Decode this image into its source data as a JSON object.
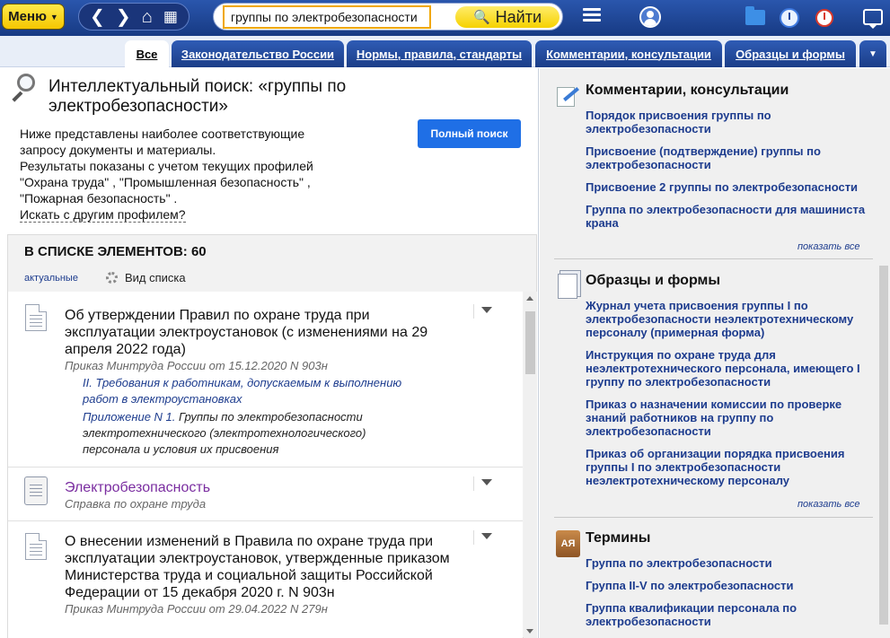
{
  "topbar": {
    "menu_label": "Меню",
    "search_value": "группы по электробезопасности",
    "find_label": "Найти"
  },
  "tabs": [
    {
      "label": "Все"
    },
    {
      "label": "Законодательство России"
    },
    {
      "label": "Нормы, правила, стандарты"
    },
    {
      "label": "Комментарии, консультации"
    },
    {
      "label": "Образцы и формы"
    }
  ],
  "main": {
    "title": "Интеллектуальный поиск: «группы по электробезопасности»",
    "intro_lines": [
      "Ниже представлены наиболее соответствующие",
      "запросу документы и материалы.",
      "Результаты показаны с учетом текущих профилей",
      "\"Охрана труда\" , \"Промышленная безопасность\" ,",
      "\"Пожарная безопасность\" ."
    ],
    "other_profile_link": "Искать с другим профилем?",
    "full_search_label": "Полный поиск",
    "list_header": "В СПИСКЕ ЭЛЕМЕНТОВ: 60",
    "actual_label": "актуальные",
    "view_list_label": "Вид списка",
    "documents": [
      {
        "title": "Об утверждении Правил по охране труда при эксплуатации электроустановок (с изменениями на 29 апреля 2022 года)",
        "subtitle": "Приказ Минтруда России от 15.12.2020 N 903н",
        "fragment1": "II. Требования к работникам, допускаемым к выполнению работ в электроустановках",
        "fragment2_link": "Приложение N 1.",
        "fragment2_text": " Группы по электробезопасности электротехнического (электротехнологического) персонала и условия их присвоения"
      },
      {
        "title": "Электробезопасность",
        "subtitle": "Справка по охране труда"
      },
      {
        "title": "О внесении изменений в Правила по охране труда при эксплуатации электроустановок, утвержденные приказом Министерства труда и социальной защиты Российской Федерации от 15 декабря 2020 г. N 903н",
        "subtitle": "Приказ Минтруда России от 29.04.2022 N 279н"
      }
    ]
  },
  "sidebar": {
    "comments": {
      "title": "Комментарии, консультации",
      "links": [
        "Порядок присвоения группы по электробезопасности",
        "Присвоение (подтверждение) группы по электробезопасности",
        "Присвоение 2 группы по электробезопасности",
        "Группа по электробезопасности для машиниста крана"
      ],
      "show_all": "показать все"
    },
    "forms": {
      "title": "Образцы и формы",
      "links": [
        "Журнал учета присвоения группы I по электробезопасности неэлектротехническому персоналу (примерная форма)",
        "Инструкция по охране труда для неэлектротехнического персонала, имеющего I группу по электробезопасности",
        "Приказ о назначении комиссии по проверке знаний работников на группу по электробезопасности",
        "Приказ об организации порядка присвоения группы I по электробезопасности неэлектротехническому персоналу"
      ],
      "show_all": "показать все"
    },
    "terms": {
      "title": "Термины",
      "icon_text": "АЯ",
      "links": [
        "Группа по электробезопасности",
        "Группа II-V по электробезопасности",
        "Группа квалификации персонала по электробезопасности"
      ]
    }
  }
}
